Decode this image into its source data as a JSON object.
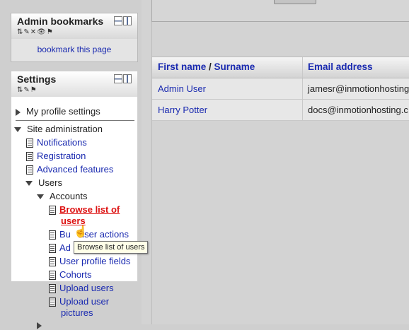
{
  "admin_bookmarks": {
    "title": "Admin bookmarks",
    "link": "bookmark this page"
  },
  "settings": {
    "title": "Settings",
    "my_profile": "My profile settings",
    "site_admin": "Site administration",
    "items": [
      "Notifications",
      "Registration",
      "Advanced features"
    ],
    "users": "Users",
    "accounts": "Accounts",
    "accounts_items": {
      "browse_line1": "Browse list of",
      "browse_line2": "users",
      "bulk": "Bulk user actions",
      "bulk_visible": "Bu",
      "bulk_visible_tail": "user actions",
      "add_visible": "Ad",
      "profile_fields": "User profile fields",
      "cohorts": "Cohorts",
      "upload_users": "Upload users",
      "upload_pictures_line1": "Upload user",
      "upload_pictures_line2": "pictures"
    }
  },
  "tooltip": "Browse list of users",
  "users_table": {
    "col_first": "First name",
    "col_sep": " / ",
    "col_surname": "Surname",
    "col_email": "Email address",
    "rows": [
      {
        "name": "Admin User",
        "email": "jamesr@inmotionhosting"
      },
      {
        "name": "Harry Potter",
        "email": "docs@inmotionhosting.c"
      }
    ]
  }
}
